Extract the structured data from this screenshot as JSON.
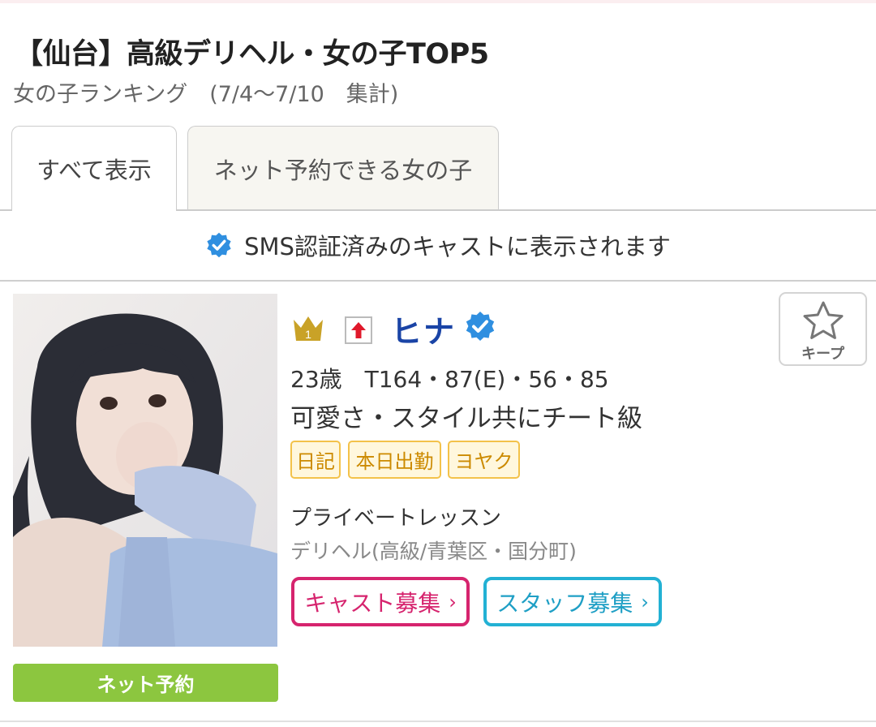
{
  "header": {
    "title": "【仙台】高級デリヘル・女の子TOP5",
    "subtitle": "女の子ランキング　(7/4～7/10　集計)"
  },
  "tabs": [
    {
      "label": "すべて表示",
      "active": true
    },
    {
      "label": "ネット予約できる女の子",
      "active": false
    }
  ],
  "sms_note": "SMS認証済みのキャストに表示されます",
  "cast": {
    "rank": "1",
    "name": "ヒナ",
    "stats": "23歳　T164・87(E)・56・85",
    "catch": "可愛さ・スタイル共にチート級",
    "tags": [
      "日記",
      "本日出勤",
      "ヨヤク"
    ],
    "shop_name": "プライベートレッスン",
    "shop_area": "デリヘル(高級/青葉区・国分町)",
    "reserve_label": "ネット予約",
    "keep_label": "キープ",
    "recruit_cast": "キャスト募集",
    "recruit_staff": "スタッフ募集",
    "chevron": "›"
  },
  "colors": {
    "name": "#1a44a6",
    "verified_badge": "#2f8fe0",
    "reserve": "#8cc63f",
    "tag_border": "#f3c24a",
    "recruit_cast": "#d6246e",
    "recruit_staff": "#23b1d4",
    "crown": "#c9a227"
  },
  "icons": {
    "verified": "check-badge-icon",
    "rank": "crown-icon",
    "trend": "up-arrow-icon",
    "keep": "star-icon"
  }
}
